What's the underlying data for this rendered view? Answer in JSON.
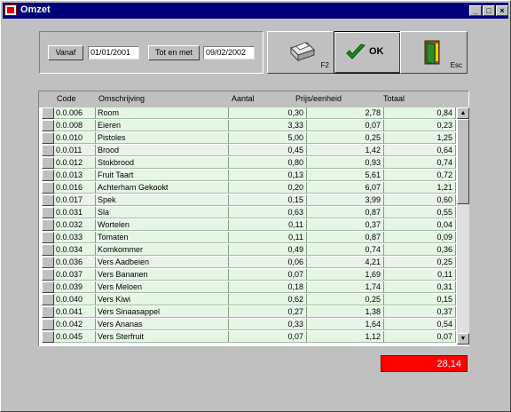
{
  "window": {
    "title": "Omzet"
  },
  "titlebar_buttons": {
    "minimize": "_",
    "maximize": "□",
    "close": "×"
  },
  "filters": {
    "from_button": "Vanaf",
    "from_value": "01/01/2001",
    "to_button": "Tot en met",
    "to_value": "09/02/2002"
  },
  "toolbar": {
    "print_key": "F2",
    "ok_label": "OK",
    "esc_key": "Esc"
  },
  "table": {
    "columns": [
      "Code",
      "Omschrijving",
      "Aantal",
      "Prijs/eenheid",
      "Totaal"
    ],
    "rows": [
      {
        "code": "0.0.006",
        "desc": "Room",
        "aantal": "0,30",
        "prijs": "2,78",
        "totaal": "0,84"
      },
      {
        "code": "0.0.008",
        "desc": "Eieren",
        "aantal": "3,33",
        "prijs": "0,07",
        "totaal": "0,23"
      },
      {
        "code": "0.0.010",
        "desc": "Pistoles",
        "aantal": "5,00",
        "prijs": "0,25",
        "totaal": "1,25"
      },
      {
        "code": "0.0.011",
        "desc": "Brood",
        "aantal": "0,45",
        "prijs": "1,42",
        "totaal": "0,64"
      },
      {
        "code": "0.0.012",
        "desc": "Stokbrood",
        "aantal": "0,80",
        "prijs": "0,93",
        "totaal": "0,74"
      },
      {
        "code": "0.0.013",
        "desc": "Fruit Taart",
        "aantal": "0,13",
        "prijs": "5,61",
        "totaal": "0,72"
      },
      {
        "code": "0.0.016",
        "desc": "Achterham Gekookt",
        "aantal": "0,20",
        "prijs": "6,07",
        "totaal": "1,21"
      },
      {
        "code": "0.0.017",
        "desc": "Spek",
        "aantal": "0,15",
        "prijs": "3,99",
        "totaal": "0,60"
      },
      {
        "code": "0.0.031",
        "desc": "Sla",
        "aantal": "0,63",
        "prijs": "0,87",
        "totaal": "0,55"
      },
      {
        "code": "0.0.032",
        "desc": "Wortelen",
        "aantal": "0,11",
        "prijs": "0,37",
        "totaal": "0,04"
      },
      {
        "code": "0.0.033",
        "desc": "Tomaten",
        "aantal": "0,11",
        "prijs": "0,87",
        "totaal": "0,09"
      },
      {
        "code": "0.0.034",
        "desc": "Komkommer",
        "aantal": "0,49",
        "prijs": "0,74",
        "totaal": "0,36"
      },
      {
        "code": "0.0.036",
        "desc": "Vers Aadbeien",
        "aantal": "0,06",
        "prijs": "4,21",
        "totaal": "0,25"
      },
      {
        "code": "0.0.037",
        "desc": "Vers Bananen",
        "aantal": "0,07",
        "prijs": "1,69",
        "totaal": "0,11"
      },
      {
        "code": "0.0.039",
        "desc": "Vers Meloen",
        "aantal": "0,18",
        "prijs": "1,74",
        "totaal": "0,31"
      },
      {
        "code": "0.0.040",
        "desc": "Vers Kiwi",
        "aantal": "0,62",
        "prijs": "0,25",
        "totaal": "0,15"
      },
      {
        "code": "0.0.041",
        "desc": "Vers Sinaasappel",
        "aantal": "0,27",
        "prijs": "1,38",
        "totaal": "0,37"
      },
      {
        "code": "0.0.042",
        "desc": "Vers Ananas",
        "aantal": "0,33",
        "prijs": "1,64",
        "totaal": "0,54"
      },
      {
        "code": "0.0.045",
        "desc": "Vers Sterfruit",
        "aantal": "0,07",
        "prijs": "1,12",
        "totaal": "0,07"
      }
    ]
  },
  "scrollbar": {
    "up": "▲",
    "down": "▼"
  },
  "total": {
    "value": "28,14"
  },
  "colors": {
    "titlebar": "#00007b",
    "row_bg": "#e6f5e6",
    "total_bg": "#ff0000"
  }
}
